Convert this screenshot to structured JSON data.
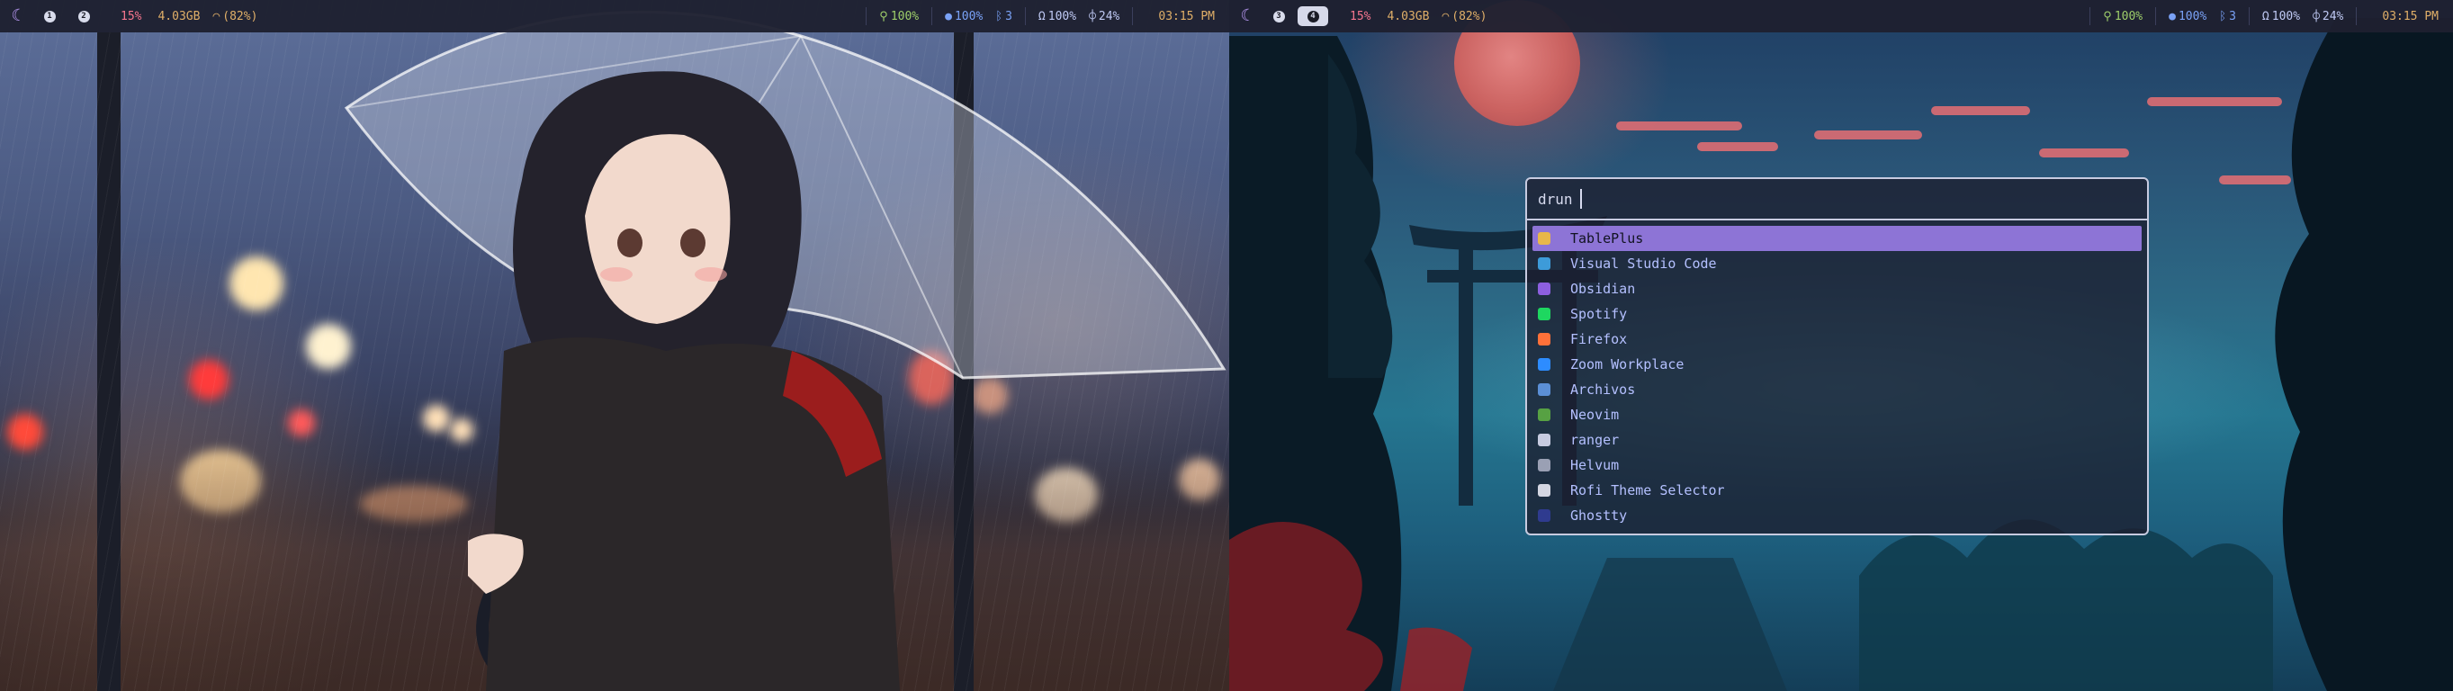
{
  "monitors": [
    {
      "id": "left",
      "bar": {
        "workspaces": [
          {
            "label": "1",
            "active": false
          },
          {
            "label": "2",
            "active": false
          }
        ],
        "cpu": "15%",
        "memory": "4.03GB",
        "wifi": "(82%)",
        "battery": "100%",
        "brightness": "100%",
        "bluetooth": "3",
        "volume": "100%",
        "mic": "24%",
        "clock": "03:15 PM"
      }
    },
    {
      "id": "right",
      "bar": {
        "workspaces": [
          {
            "label": "3",
            "active": false
          },
          {
            "label": "4",
            "active": true
          }
        ],
        "cpu": "15%",
        "memory": "4.03GB",
        "wifi": "(82%)",
        "battery": "100%",
        "brightness": "100%",
        "bluetooth": "3",
        "volume": "100%",
        "mic": "24%",
        "clock": "03:15 PM"
      }
    }
  ],
  "launcher": {
    "prompt": "drun",
    "query": "",
    "items": [
      {
        "label": "TablePlus",
        "icon": "tableplus-icon",
        "color": "#e8b74a",
        "selected": true
      },
      {
        "label": "Visual Studio Code",
        "icon": "vscode-icon",
        "color": "#3d9bd9",
        "selected": false
      },
      {
        "label": "Obsidian",
        "icon": "obsidian-icon",
        "color": "#8d5fe0",
        "selected": false
      },
      {
        "label": "Spotify",
        "icon": "spotify-icon",
        "color": "#1ed760",
        "selected": false
      },
      {
        "label": "Firefox",
        "icon": "firefox-icon",
        "color": "#ff7139",
        "selected": false
      },
      {
        "label": "Zoom Workplace",
        "icon": "zoom-icon",
        "color": "#2d8cff",
        "selected": false
      },
      {
        "label": "Archivos",
        "icon": "files-icon",
        "color": "#5b8fd6",
        "selected": false
      },
      {
        "label": "Neovim",
        "icon": "neovim-icon",
        "color": "#57a143",
        "selected": false
      },
      {
        "label": "ranger",
        "icon": "terminal-icon",
        "color": "#c7cbe0",
        "selected": false
      },
      {
        "label": "Helvum",
        "icon": "folder-icon",
        "color": "#9aa0b4",
        "selected": false
      },
      {
        "label": "Rofi Theme Selector",
        "icon": "theme-selector-icon",
        "color": "#d4d6e2",
        "selected": false
      },
      {
        "label": "Ghostty",
        "icon": "ghostty-icon",
        "color": "#2f3b8f",
        "selected": false
      }
    ]
  }
}
